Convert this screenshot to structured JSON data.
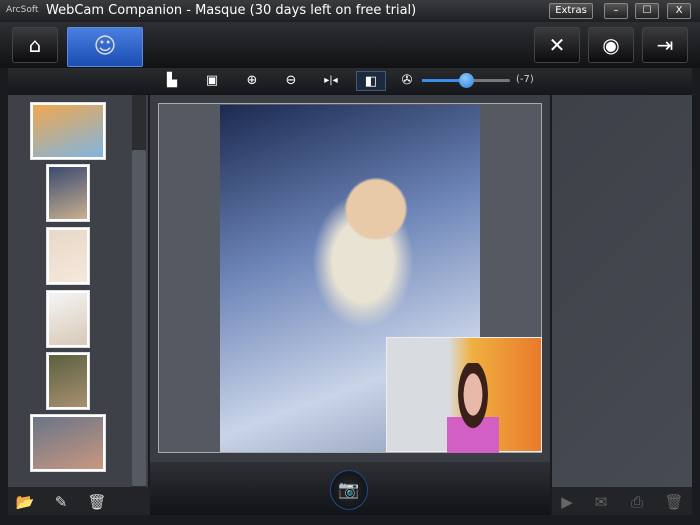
{
  "title": {
    "brand": "ArcSoft",
    "text": "WebCam Companion - Masque (30 days left on free trial)",
    "extras": "Extras",
    "minimize": "–",
    "maximize": "☐",
    "close": "X"
  },
  "toolbar": {
    "home_icon": "⌂",
    "masque_icon": "☺",
    "settings_icon": "✕",
    "webcam_icon": "◉",
    "export_icon": "⇥"
  },
  "tools": {
    "face_icon": "▙",
    "frame_icon": "▣",
    "zoom_in": "⊕",
    "zoom_out": "⊖",
    "mirror": "▸|◂",
    "pip": "◧",
    "effect": "✇",
    "slider_value": "(-7)",
    "slider_fraction": 0.5
  },
  "thumbnails": [
    {
      "colors": [
        "#f0a850",
        "#7fb5e0"
      ]
    },
    {
      "colors": [
        "#3a4a70",
        "#c9b090"
      ]
    },
    {
      "colors": [
        "#e8d8c8",
        "#f5e8dc"
      ]
    },
    {
      "colors": [
        "#f5f5f5",
        "#d8c8b8"
      ]
    },
    {
      "colors": [
        "#5a6040",
        "#a89070"
      ]
    },
    {
      "colors": [
        "#6a7488",
        "#c89880"
      ]
    }
  ],
  "bottom": {
    "camera_icon": "📷",
    "open_icon": "📂",
    "edit_icon": "✎",
    "trash_icon": "🗑",
    "slideshow_icon": "▶",
    "email_icon": "✉",
    "print_icon": "⎙",
    "delete_icon": "🗑"
  }
}
